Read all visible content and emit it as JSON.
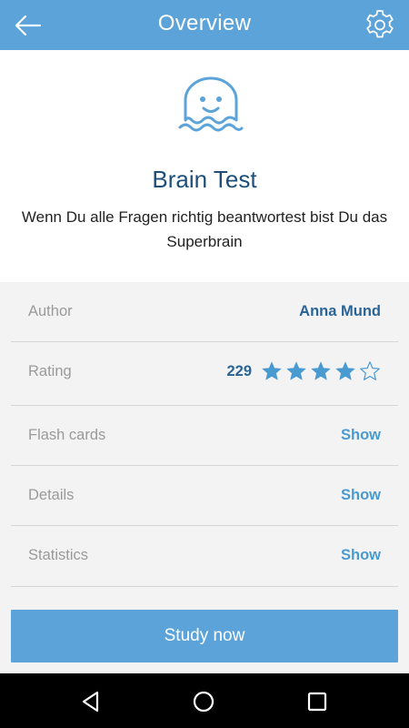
{
  "appbar": {
    "title": "Overview",
    "back_icon": "arrow-left-icon",
    "settings_icon": "gear-icon"
  },
  "deck": {
    "icon": "ghost-icon",
    "title": "Brain Test",
    "description": "Wenn Du alle Fragen richtig beantwortest bist Du das Superbrain"
  },
  "details": {
    "author_label": "Author",
    "author_value": "Anna Mund",
    "rating_label": "Rating",
    "rating_count": "229",
    "rating_stars": 4,
    "rating_max": 5,
    "flashcards_label": "Flash cards",
    "flashcards_action": "Show",
    "details_label": "Details",
    "details_action": "Show",
    "statistics_label": "Statistics",
    "statistics_action": "Show"
  },
  "study_button": "Study now",
  "colors": {
    "primary": "#5ba3d8",
    "title_text": "#1d4f7a",
    "value_text": "#2a6496",
    "star": "#4a9ad2"
  },
  "system_nav": [
    "nav-back-icon",
    "nav-home-icon",
    "nav-recents-icon"
  ]
}
